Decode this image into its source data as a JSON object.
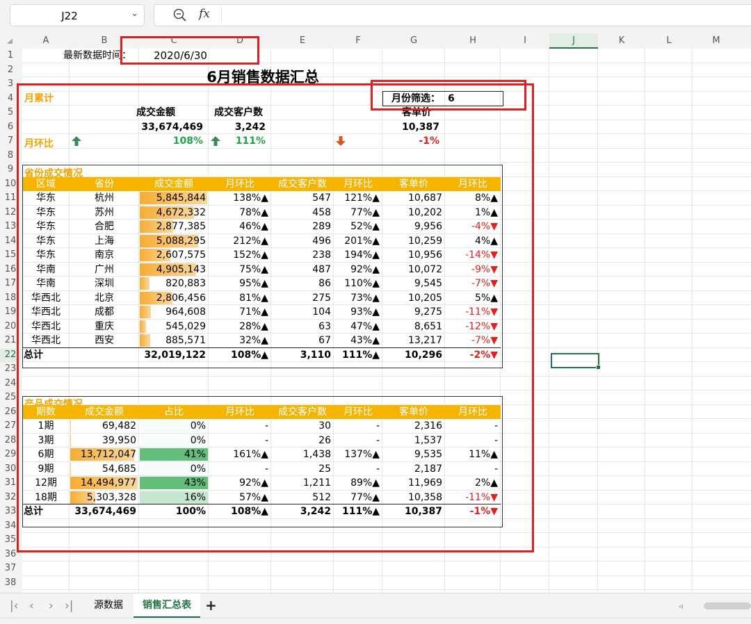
{
  "namebox": {
    "cell": "J22"
  },
  "columns": [
    "A",
    "B",
    "C",
    "D",
    "E",
    "F",
    "G",
    "H",
    "I",
    "J",
    "K",
    "L",
    "M"
  ],
  "rows": [
    "1",
    "2",
    "3",
    "4",
    "5",
    "6",
    "7",
    "8",
    "9",
    "10",
    "11",
    "12",
    "13",
    "14",
    "15",
    "16",
    "17",
    "18",
    "19",
    "20",
    "21",
    "22",
    "23",
    "24",
    "25",
    "26",
    "27",
    "28",
    "29",
    "30",
    "31",
    "32",
    "33",
    "34",
    "35",
    "36",
    "37",
    "38"
  ],
  "header": {
    "date_label": "最新数据时间：",
    "date_value": "2020/6/30",
    "title": "6月销售数据汇总",
    "month_filter_label": "月份筛选：",
    "month_filter_value": "6"
  },
  "monthly": {
    "section_title": "月累计",
    "mom_label": "月环比",
    "metrics": [
      {
        "label": "成交金额",
        "value": "33,674,469",
        "mom": "108%",
        "direction": "up"
      },
      {
        "label": "成交客户数",
        "value": "3,242",
        "mom": "111%",
        "direction": "up"
      },
      {
        "label": "客单价",
        "value": "10,387",
        "mom": "-1%",
        "direction": "down"
      }
    ]
  },
  "province": {
    "section_title": "省份成交情况",
    "headers": [
      "区域",
      "省份",
      "成交金额",
      "月环比",
      "成交客户数",
      "月环比",
      "客单价",
      "月环比"
    ],
    "rows": [
      {
        "region": "华东",
        "province": "杭州",
        "amount": "5,845,844",
        "amount_ratio": 1.0,
        "mom1": "138%▲",
        "customers": "547",
        "mom2": "121%▲",
        "avg": "10,687",
        "mom3": "8%▲",
        "mom3_neg": false
      },
      {
        "region": "华东",
        "province": "苏州",
        "amount": "4,672,332",
        "amount_ratio": 0.8,
        "mom1": "78%▲",
        "customers": "458",
        "mom2": "77%▲",
        "avg": "10,202",
        "mom3": "1%▲",
        "mom3_neg": false
      },
      {
        "region": "华东",
        "province": "合肥",
        "amount": "2,877,385",
        "amount_ratio": 0.49,
        "mom1": "46%▲",
        "customers": "289",
        "mom2": "52%▲",
        "avg": "9,956",
        "mom3": "-4%▼",
        "mom3_neg": true
      },
      {
        "region": "华东",
        "province": "上海",
        "amount": "5,088,295",
        "amount_ratio": 0.87,
        "mom1": "212%▲",
        "customers": "496",
        "mom2": "201%▲",
        "avg": "10,259",
        "mom3": "4%▲",
        "mom3_neg": false
      },
      {
        "region": "华东",
        "province": "南京",
        "amount": "2,607,575",
        "amount_ratio": 0.45,
        "mom1": "152%▲",
        "customers": "238",
        "mom2": "194%▲",
        "avg": "10,956",
        "mom3": "-14%▼",
        "mom3_neg": true
      },
      {
        "region": "华南",
        "province": "广州",
        "amount": "4,905,143",
        "amount_ratio": 0.84,
        "mom1": "75%▲",
        "customers": "487",
        "mom2": "92%▲",
        "avg": "10,072",
        "mom3": "-9%▼",
        "mom3_neg": true
      },
      {
        "region": "华南",
        "province": "深圳",
        "amount": "820,883",
        "amount_ratio": 0.14,
        "mom1": "95%▲",
        "customers": "86",
        "mom2": "110%▲",
        "avg": "9,545",
        "mom3": "-7%▼",
        "mom3_neg": true
      },
      {
        "region": "华西北",
        "province": "北京",
        "amount": "2,806,456",
        "amount_ratio": 0.48,
        "mom1": "81%▲",
        "customers": "275",
        "mom2": "73%▲",
        "avg": "10,205",
        "mom3": "5%▲",
        "mom3_neg": false
      },
      {
        "region": "华西北",
        "province": "成都",
        "amount": "964,608",
        "amount_ratio": 0.165,
        "mom1": "71%▲",
        "customers": "104",
        "mom2": "93%▲",
        "avg": "9,275",
        "mom3": "-11%▼",
        "mom3_neg": true
      },
      {
        "region": "华西北",
        "province": "重庆",
        "amount": "545,029",
        "amount_ratio": 0.093,
        "mom1": "28%▲",
        "customers": "63",
        "mom2": "47%▲",
        "avg": "8,651",
        "mom3": "-12%▼",
        "mom3_neg": true
      },
      {
        "region": "华西北",
        "province": "西安",
        "amount": "885,571",
        "amount_ratio": 0.15,
        "mom1": "32%▲",
        "customers": "67",
        "mom2": "43%▲",
        "avg": "13,217",
        "mom3": "-7%▼",
        "mom3_neg": true
      }
    ],
    "total": {
      "label": "总计",
      "amount": "32,019,122",
      "mom1": "108%▲",
      "customers": "3,110",
      "mom2": "111%▲",
      "avg": "10,296",
      "mom3": "-2%▼"
    }
  },
  "product": {
    "section_title": "产品成交情况",
    "headers": [
      "期数",
      "成交金额",
      "占比",
      "月环比",
      "成交客户数",
      "月环比",
      "客单价",
      "月环比"
    ],
    "rows": [
      {
        "period": "1期",
        "amount": "69,482",
        "amount_ratio": 0.005,
        "share": "0%",
        "share_ratio": 0.0,
        "mom1": "-",
        "customers": "30",
        "mom2": "-",
        "avg": "2,316",
        "mom3": "-",
        "mom3_neg": false
      },
      {
        "period": "3期",
        "amount": "39,950",
        "amount_ratio": 0.003,
        "share": "0%",
        "share_ratio": 0.0,
        "mom1": "-",
        "customers": "26",
        "mom2": "-",
        "avg": "1,537",
        "mom3": "-",
        "mom3_neg": false
      },
      {
        "period": "6期",
        "amount": "13,712,047",
        "amount_ratio": 0.946,
        "share": "41%",
        "share_ratio": 0.95,
        "mom1": "161%▲",
        "customers": "1,438",
        "mom2": "137%▲",
        "avg": "9,535",
        "mom3": "11%▲",
        "mom3_neg": false
      },
      {
        "period": "9期",
        "amount": "54,685",
        "amount_ratio": 0.004,
        "share": "0%",
        "share_ratio": 0.0,
        "mom1": "-",
        "customers": "25",
        "mom2": "-",
        "avg": "2,187",
        "mom3": "-",
        "mom3_neg": false
      },
      {
        "period": "12期",
        "amount": "14,494,977",
        "amount_ratio": 1.0,
        "share": "43%",
        "share_ratio": 1.0,
        "mom1": "92%▲",
        "customers": "1,211",
        "mom2": "89%▲",
        "avg": "11,969",
        "mom3": "2%▲",
        "mom3_neg": false
      },
      {
        "period": "18期",
        "amount": "5,303,328",
        "amount_ratio": 0.366,
        "share": "16%",
        "share_ratio": 0.37,
        "mom1": "57%▲",
        "customers": "512",
        "mom2": "77%▲",
        "avg": "10,358",
        "mom3": "-11%▼",
        "mom3_neg": true
      }
    ],
    "total": {
      "label": "总计",
      "amount": "33,674,469",
      "share": "100%",
      "mom1": "108%▲",
      "customers": "3,242",
      "mom2": "111%▲",
      "avg": "10,387",
      "mom3": "-1%▼"
    }
  },
  "sheet_tabs": [
    {
      "label": "源数据",
      "active": false
    },
    {
      "label": "销售汇总表",
      "active": true
    }
  ],
  "colors": {
    "accent": "#217346",
    "header_band": "#f5b400",
    "data_bar": "#f6ac33",
    "green_scale_high": "#63be7b",
    "highlight_box": "#e02020",
    "up_arrow": "#3a8a5a",
    "down_arrow": "#e0541c"
  }
}
